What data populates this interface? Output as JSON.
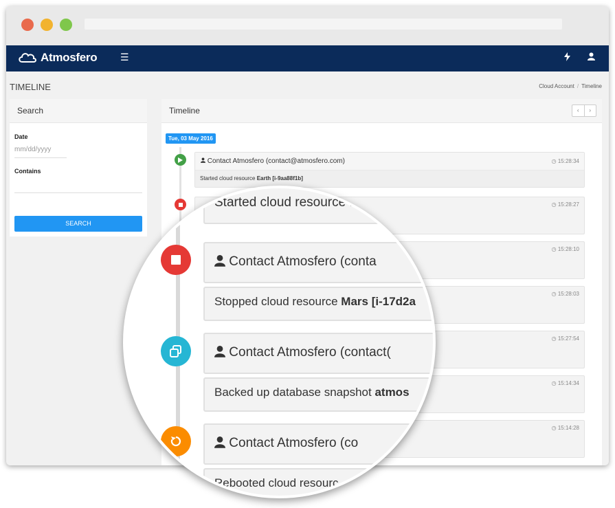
{
  "app": {
    "name": "Atmosfero"
  },
  "colors": {
    "navbar": "#0b2b5a",
    "accent": "#2196f3",
    "green": "#43a047",
    "red": "#e53935",
    "cyan": "#26b6d4",
    "orange": "#fb8c00"
  },
  "page": {
    "title": "TIMELINE",
    "breadcrumb": [
      "Cloud Account",
      "Timeline"
    ],
    "breadcrumb_sep": "/"
  },
  "search": {
    "title": "Search",
    "date_label": "Date",
    "date_placeholder": "mm/dd/yyyy",
    "contains_label": "Contains",
    "button": "SEARCH"
  },
  "timeline": {
    "title": "Timeline",
    "prev": "‹",
    "next": "›",
    "date": "Tue, 03 May 2016",
    "items": [
      {
        "time": "15:28:34",
        "user": "Contact Atmosfero (contact@atmosfero.com)",
        "action": "Started cloud resource ",
        "resource": "Earth [i-9aa88f1b]",
        "icon": "play-icon",
        "color": "#43a047"
      },
      {
        "time": "15:28:27",
        "user": "",
        "action": "",
        "resource": "",
        "icon": "stop-icon",
        "color": "#e53935"
      },
      {
        "time": "15:28:10",
        "user": "",
        "action": "",
        "resource": "",
        "icon": "",
        "color": ""
      },
      {
        "time": "15:28:03",
        "user": "",
        "action": "",
        "resource": "",
        "icon": "",
        "color": ""
      },
      {
        "time": "15:27:54",
        "user": "",
        "action": "",
        "resource": "",
        "icon": "",
        "color": ""
      },
      {
        "time": "15:14:34",
        "user": "",
        "action": "",
        "resource": "",
        "icon": "",
        "color": ""
      },
      {
        "time": "15:14:28",
        "user": "",
        "action": "",
        "resource": "",
        "icon": "",
        "color": ""
      }
    ]
  },
  "magnifier": {
    "line1": "Started cloud resource E",
    "line1_tail": "m)",
    "line2_user": "Contact Atmosfero (conta",
    "line3_pre": "Stopped cloud resource ",
    "line3_bold": "Mars [i-17d2a",
    "line4_user": "Contact Atmosfero (contact(",
    "line5_pre": "Backed up database snapshot ",
    "line5_bold": "atmos",
    "line6_user": "Contact Atmosfero (co",
    "line7": "Rebooted cloud resourc"
  }
}
